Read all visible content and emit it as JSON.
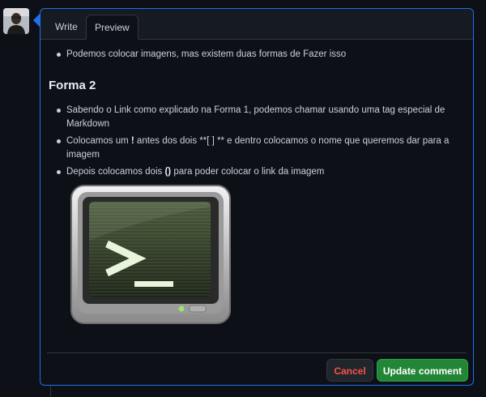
{
  "tabs": {
    "write_label": "Write",
    "preview_label": "Preview"
  },
  "preview": {
    "intro_items": [
      "Podemos colocar imagens, mas existem duas formas de Fazer isso"
    ],
    "heading": "Forma 2",
    "items": [
      {
        "before": "Sabendo o Link como explicado na Forma 1, podemos chamar usando uma tag especial de Markdown",
        "bold": "",
        "after": ""
      },
      {
        "before": "Colocamos um ",
        "bold": "!",
        "after": " antes dos dois **[ ] ** e dentro colocamos o nome que queremos dar para a imagem"
      },
      {
        "before": "Depois colocamos dois ",
        "bold": "()",
        "after": " para poder colocar o link da imagem"
      }
    ],
    "image_icon": "terminal-icon"
  },
  "actions": {
    "cancel_label": "Cancel",
    "update_label": "Update comment"
  },
  "colors": {
    "accent": "#1f6feb",
    "primary_button": "#238636",
    "danger_text": "#f85149",
    "background": "#0d1117"
  }
}
